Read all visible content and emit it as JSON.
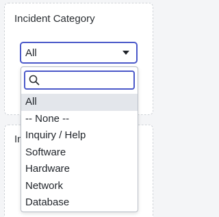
{
  "incident_category": {
    "title": "Incident Category",
    "selected_value": "All",
    "search": {
      "value": "",
      "placeholder": ""
    },
    "options": [
      "All",
      "-- None --",
      "Inquiry / Help",
      "Software",
      "Hardware",
      "Network",
      "Database"
    ],
    "selected_index": 0
  },
  "second_card": {
    "title_visible": "In"
  },
  "colors": {
    "focus_border": "#4a58c9",
    "selected_option_bg": "#e3e6eb",
    "page_bg": "#f4f5f7"
  },
  "icons": {
    "search": "search-icon",
    "caret": "caret-down-icon"
  }
}
